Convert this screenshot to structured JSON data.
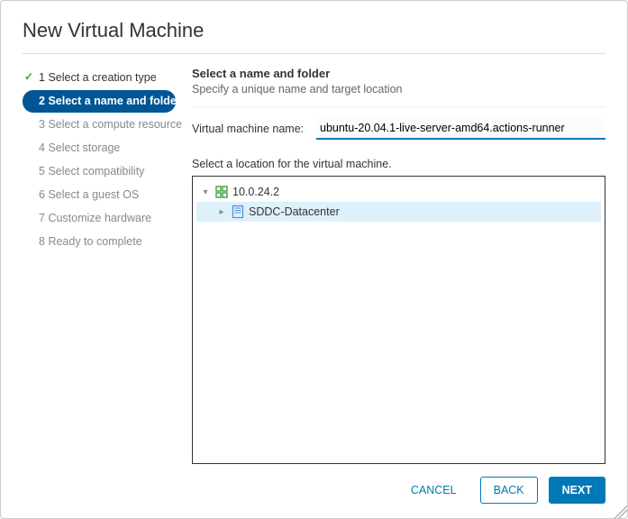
{
  "title": "New Virtual Machine",
  "steps": [
    {
      "num": "1",
      "label": "Select a creation type",
      "state": "completed"
    },
    {
      "num": "2",
      "label": "Select a name and folder",
      "state": "active"
    },
    {
      "num": "3",
      "label": "Select a compute resource",
      "state": "future"
    },
    {
      "num": "4",
      "label": "Select storage",
      "state": "future"
    },
    {
      "num": "5",
      "label": "Select compatibility",
      "state": "future"
    },
    {
      "num": "6",
      "label": "Select a guest OS",
      "state": "future"
    },
    {
      "num": "7",
      "label": "Customize hardware",
      "state": "future"
    },
    {
      "num": "8",
      "label": "Ready to complete",
      "state": "future"
    }
  ],
  "section": {
    "heading": "Select a name and folder",
    "sub": "Specify a unique name and target location"
  },
  "vm_name": {
    "label": "Virtual machine name:",
    "value": "ubuntu-20.04.1-live-server-amd64.actions-runner"
  },
  "location": {
    "label": "Select a location for the virtual machine.",
    "root": {
      "label": "10.0.24.2",
      "icon": "host-icon",
      "expanded": true
    },
    "child": {
      "label": "SDDC-Datacenter",
      "icon": "datacenter-icon",
      "expanded": false,
      "selected": true
    }
  },
  "footer": {
    "cancel": "CANCEL",
    "back": "BACK",
    "next": "NEXT"
  }
}
